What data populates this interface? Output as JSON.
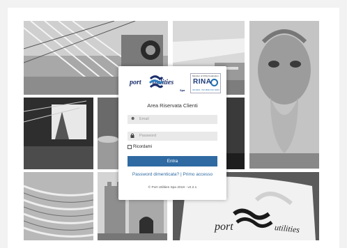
{
  "brand": {
    "word1": "port",
    "word2": "utilities",
    "suffix": "Spa"
  },
  "cert": {
    "top_text": "Member of CISQ Federation",
    "name": "RINA",
    "bottom_text": "ISO 9001 - ISO 45001 ISO 14001"
  },
  "login": {
    "title": "Area Riservata Clienti",
    "email_placeholder": "Email",
    "password_placeholder": "Password",
    "remember_label": "Ricordami",
    "submit_label": "Entra",
    "forgot_link": "Password dimenticata?",
    "separator": "|",
    "first_access_link": "Primo accesso",
    "copyright": "© Port Utilities Spa 2018 - v2.2.1"
  },
  "banner": {
    "word1": "port",
    "word2": "utilities"
  },
  "icons": {
    "email": "user-icon",
    "password": "lock-icon",
    "logo": "wave-mark-icon"
  },
  "colors": {
    "primary": "#2f6aa3",
    "brand": "#1b2f6b"
  }
}
